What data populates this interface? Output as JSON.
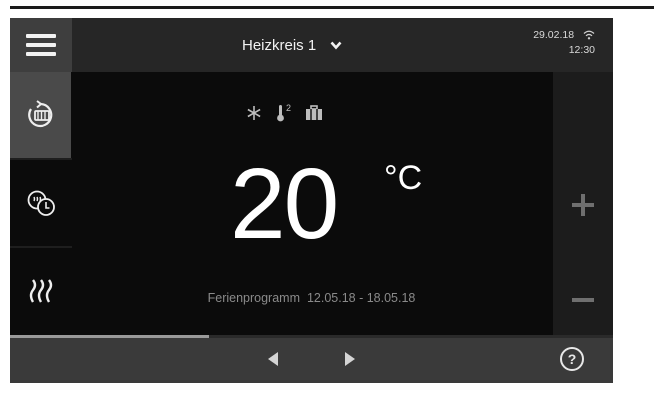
{
  "header": {
    "circuit_label": "Heizkreis 1",
    "date": "29.02.18",
    "time": "12:30"
  },
  "sidebar": {
    "items": [
      {
        "icon": "heating-circuit-icon",
        "active": true
      },
      {
        "icon": "time-program-icon",
        "active": false
      },
      {
        "icon": "heat-waves-icon",
        "active": false
      }
    ]
  },
  "main": {
    "status_icons": [
      "snowflake-icon",
      "thermometer-2-icon",
      "suitcase-icon"
    ],
    "thermometer_superscript": "2",
    "temperature_value": "20",
    "temperature_unit": "°C",
    "holiday_text": "Ferienprogramm  12.05.18 - 18.05.18"
  },
  "footer": {
    "progress": 0.33
  },
  "colors": {
    "background": "#0b0b0b",
    "header": "#262626",
    "active_sidebar": "#4a4a4a",
    "footer": "#3a3a3a",
    "text": "#ffffff",
    "muted_text": "#8a8a8a"
  }
}
